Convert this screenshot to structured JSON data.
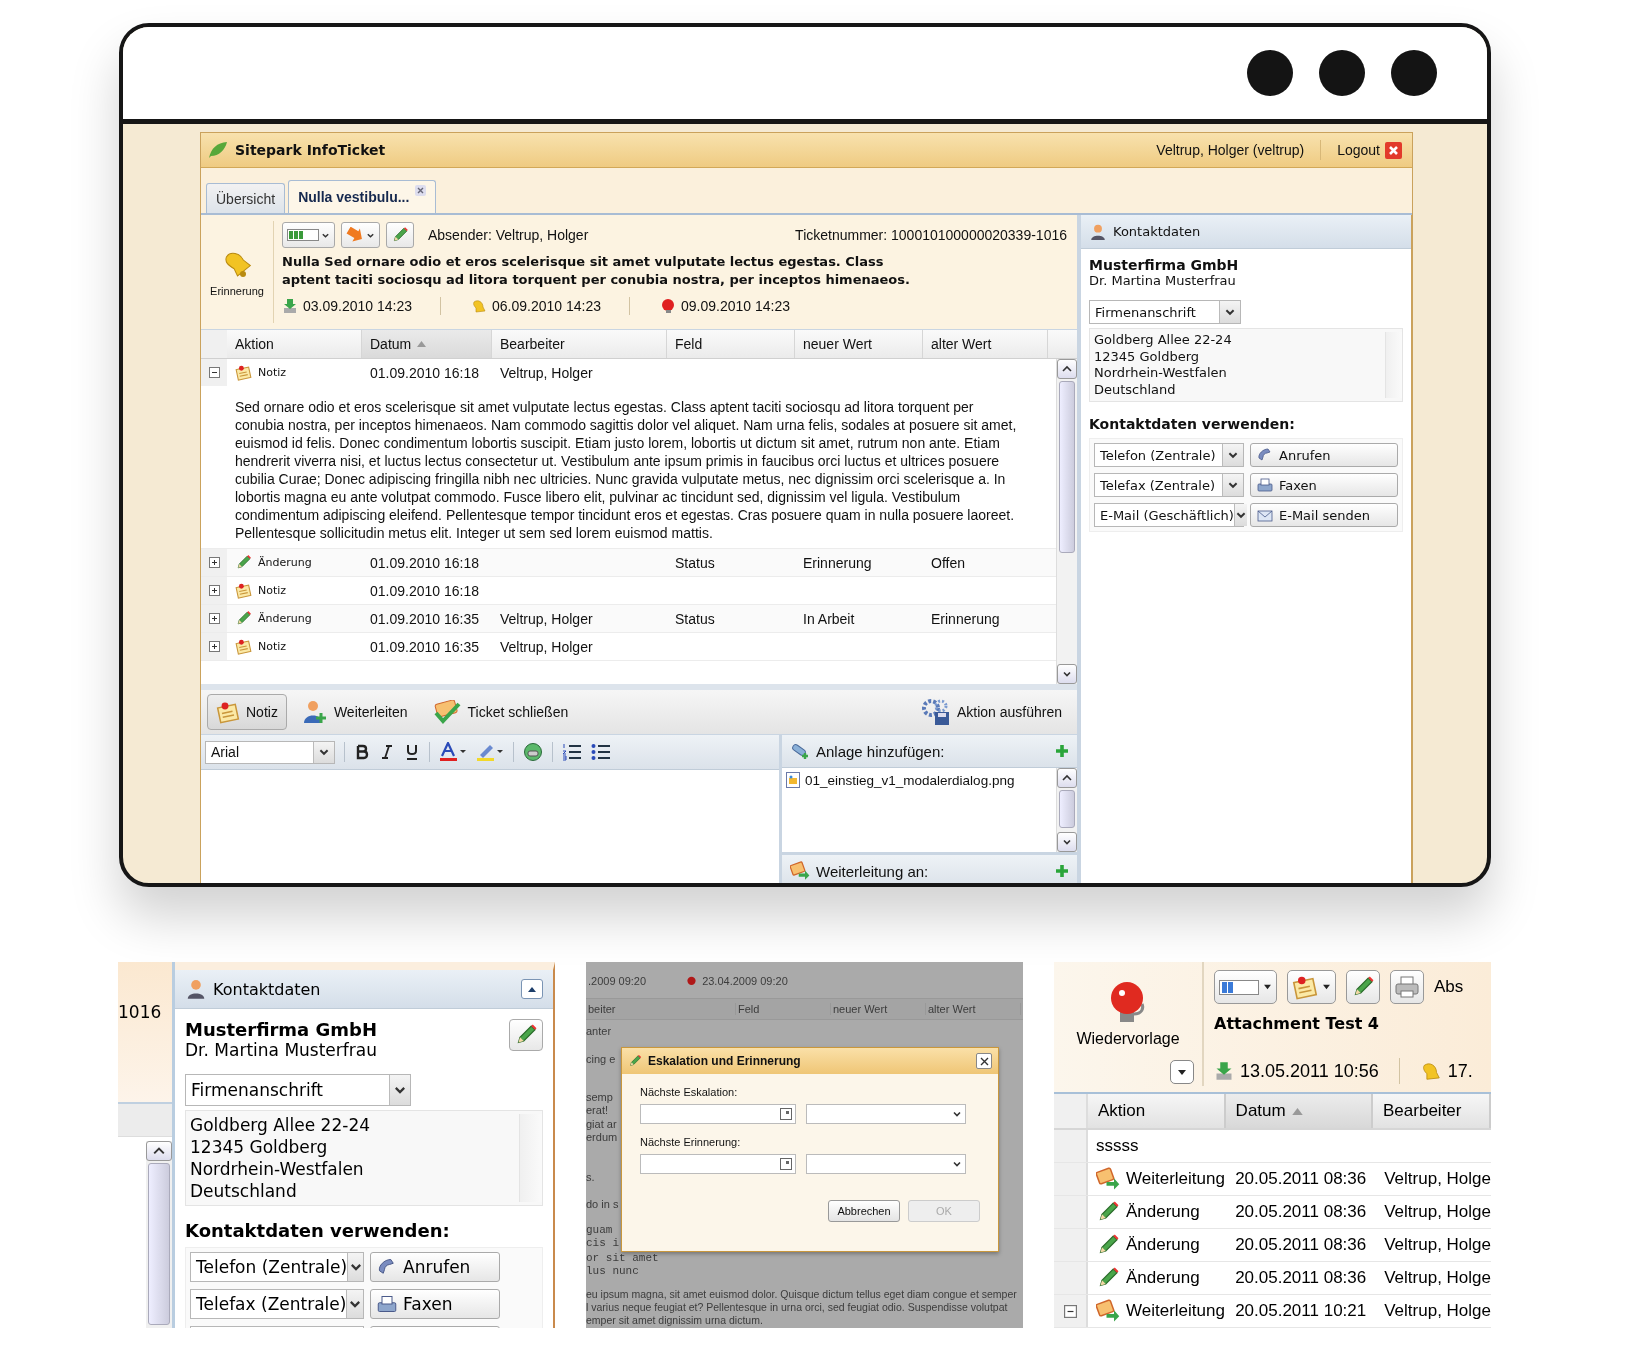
{
  "app": {
    "title": "Sitepark InfoTicket",
    "user": "Veltrup, Holger (veltrup)",
    "logout": "Logout"
  },
  "tabs": [
    {
      "label": "Übersicht",
      "selected": false
    },
    {
      "label": "Nulla vestibulu...",
      "selected": true
    }
  ],
  "ticket": {
    "reminder_label": "Erinnerung",
    "sender": "Absender: Veltrup, Holger",
    "ticket_number": "Ticketnummer: 100010100000020339-1016",
    "subject": "Nulla Sed ornare odio et eros scelerisque sit amet vulputate lectus egestas. Class aptent taciti sociosqu ad litora torquent per conubia nostra, per inceptos himenaeos.",
    "dates": [
      {
        "kind": "created",
        "text": "03.09.2010 14:23"
      },
      {
        "kind": "reminder",
        "text": "06.09.2010 14:23"
      },
      {
        "kind": "escalation",
        "text": "09.09.2010 14:23"
      }
    ]
  },
  "history": {
    "columns": [
      {
        "label": "Aktion",
        "sorted": false
      },
      {
        "label": "Datum",
        "sorted": true
      },
      {
        "label": "Bearbeiter",
        "sorted": false
      },
      {
        "label": "Feld",
        "sorted": false
      },
      {
        "label": "neuer Wert",
        "sorted": false
      },
      {
        "label": "alter Wert",
        "sorted": false
      }
    ],
    "rows": [
      {
        "kind": "note",
        "expanded": true,
        "action": "Notiz",
        "date": "01.09.2010 16:18",
        "editor": "Veltrup, Holger",
        "text": "Sed ornare odio et eros scelerisque sit amet vulputate lectus egestas. Class aptent taciti sociosqu ad litora torquent per conubia nostra, per inceptos himenaeos. Nam commodo sagittis dolor vel aliquet. Nam urna felis, sodales at posuere sit amet, euismod id felis. Donec condimentum lobortis suscipit. Etiam justo lorem, lobortis ut dictum sit amet, rutrum non ante. Etiam hendrerit viverra nisi, et luctus lectus consectetur ut. Vestibulum ante ipsum primis in faucibus orci luctus et ultrices posuere cubilia Curae; Donec adipiscing fringilla nibh nec ultricies. Nunc gravida vulputate metus, nec dignissim orci scelerisque a. In lobortis magna eu ante volutpat commodo. Fusce libero elit, pulvinar ac tincidunt sed, dignissim vel ligula. Vestibulum condimentum adipiscing eleifend. Pellentesque tempor tincidunt eros et egestas. Cras posuere quam in nulla posuere laoreet. Pellentesque sollicitudin metus elit. Integer ut sem sed lorem euismod mattis."
      },
      {
        "kind": "change",
        "expanded": false,
        "action": "Änderung",
        "date": "01.09.2010 16:18",
        "field": "Status",
        "new_value": "Erinnerung",
        "old_value": "Offen"
      },
      {
        "kind": "note",
        "expanded": false,
        "action": "Notiz",
        "date": "01.09.2010 16:18"
      },
      {
        "kind": "change",
        "expanded": false,
        "action": "Änderung",
        "date": "01.09.2010 16:35",
        "editor": "Veltrup, Holger",
        "field": "Status",
        "new_value": "In Arbeit",
        "old_value": "Erinnerung"
      },
      {
        "kind": "note",
        "expanded": false,
        "action": "Notiz",
        "date": "01.09.2010 16:35",
        "editor": "Veltrup, Holger"
      }
    ]
  },
  "action_bar": {
    "buttons": [
      {
        "kind": "note",
        "label": "Notiz",
        "selected": true
      },
      {
        "kind": "forward",
        "label": "Weiterleiten",
        "selected": false
      },
      {
        "kind": "close",
        "label": "Ticket schließen",
        "selected": false
      }
    ],
    "execute": "Aktion ausführen"
  },
  "editor": {
    "font": "Arial"
  },
  "attachments": {
    "title": "Anlage hinzufügen:",
    "files": [
      "01_einstieg_v1_modalerdialog.png"
    ]
  },
  "forward": {
    "title": "Weiterleitung an:"
  },
  "contact": {
    "title": "Kontaktdaten",
    "company": "Musterfirma GmbH",
    "person": "Dr. Martina Musterfrau",
    "address_type": "Firmenanschrift",
    "address": [
      "Goldberg Allee 22-24",
      "12345 Goldberg",
      "Nordrhein-Westfalen",
      "Deutschland"
    ],
    "use_title": "Kontaktdaten verwenden:",
    "actions": [
      {
        "kind": "phone",
        "channel": "Telefon (Zentrale)",
        "button": "Anrufen"
      },
      {
        "kind": "fax",
        "channel": "Telefax (Zentrale)",
        "button": "Faxen"
      },
      {
        "kind": "mail",
        "channel": "E-Mail (Geschäftlich)",
        "button": "E-Mail senden"
      }
    ]
  },
  "detail_contact": {
    "ticket_number_part": "1016",
    "title": "Kontaktdaten",
    "company": "Musterfirma GmbH",
    "person": "Dr. Martina Musterfrau",
    "address_type": "Firmenanschrift",
    "address": [
      "Goldberg Allee 22-24",
      "12345 Goldberg",
      "Nordrhein-Westfalen",
      "Deutschland"
    ],
    "use_title": "Kontaktdaten verwenden:",
    "actions": [
      {
        "kind": "phone",
        "channel": "Telefon (Zentrale)",
        "button": "Anrufen"
      },
      {
        "kind": "fax",
        "channel": "Telefax (Zentrale)",
        "button": "Faxen"
      }
    ]
  },
  "detail_dialog": {
    "background": {
      "dates": [
        ".2009 09:20",
        "23.04.2009 09:20"
      ],
      "columns": [
        "beiter",
        "Feld",
        "neuer Wert",
        "alter Wert"
      ],
      "fragments": [
        "anter",
        "cing e",
        "semp",
        "erat!",
        "giat ar",
        "erdum",
        "s.",
        "do in s"
      ],
      "code_lines": [
        "guam",
        "cis i",
        "or sit amet",
        "lus nunc"
      ],
      "paragraph_lines": [
        "eu ipsum magna, sit amet euismod dolor. Quisque dictum tellus eget diam congue et semper",
        "l varius neque feugiat et? Pellentesque in urna orci, sed feugiat odio. Suspendisse volutpat",
        "emper sit amet dignissim urna dictum."
      ]
    },
    "title": "Eskalation und Erinnerung",
    "fields": [
      "Nächste Eskalation:",
      "Nächste Erinnerung:"
    ],
    "buttons": [
      {
        "label": "Abbrechen",
        "disabled": false
      },
      {
        "label": "OK",
        "disabled": true
      }
    ]
  },
  "detail_ticket": {
    "reminder_label": "Wiedervorlage",
    "sender_part": "Abs",
    "subject": "Attachment Test 4",
    "date": "13.05.2011 10:56",
    "date_part": "17.",
    "columns": [
      {
        "label": "Aktion",
        "sorted": false
      },
      {
        "label": "Datum",
        "sorted": true
      },
      {
        "label": "Bearbeiter",
        "sorted": false
      }
    ],
    "rows": [
      {
        "kind": "text",
        "action": "sssss"
      },
      {
        "kind": "forward",
        "action": "Weiterleitung",
        "date": "20.05.2011 08:36",
        "editor": "Veltrup, Holge"
      },
      {
        "kind": "change",
        "action": "Änderung",
        "date": "20.05.2011 08:36",
        "editor": "Veltrup, Holge"
      },
      {
        "kind": "change",
        "action": "Änderung",
        "date": "20.05.2011 08:36",
        "editor": "Veltrup, Holge"
      },
      {
        "kind": "change",
        "action": "Änderung",
        "date": "20.05.2011 08:36",
        "editor": "Veltrup, Holge"
      },
      {
        "kind": "forward",
        "action": "Weiterleitung",
        "date": "20.05.2011 10:21",
        "editor": "Veltrup, Holge",
        "expanded": true
      }
    ]
  }
}
